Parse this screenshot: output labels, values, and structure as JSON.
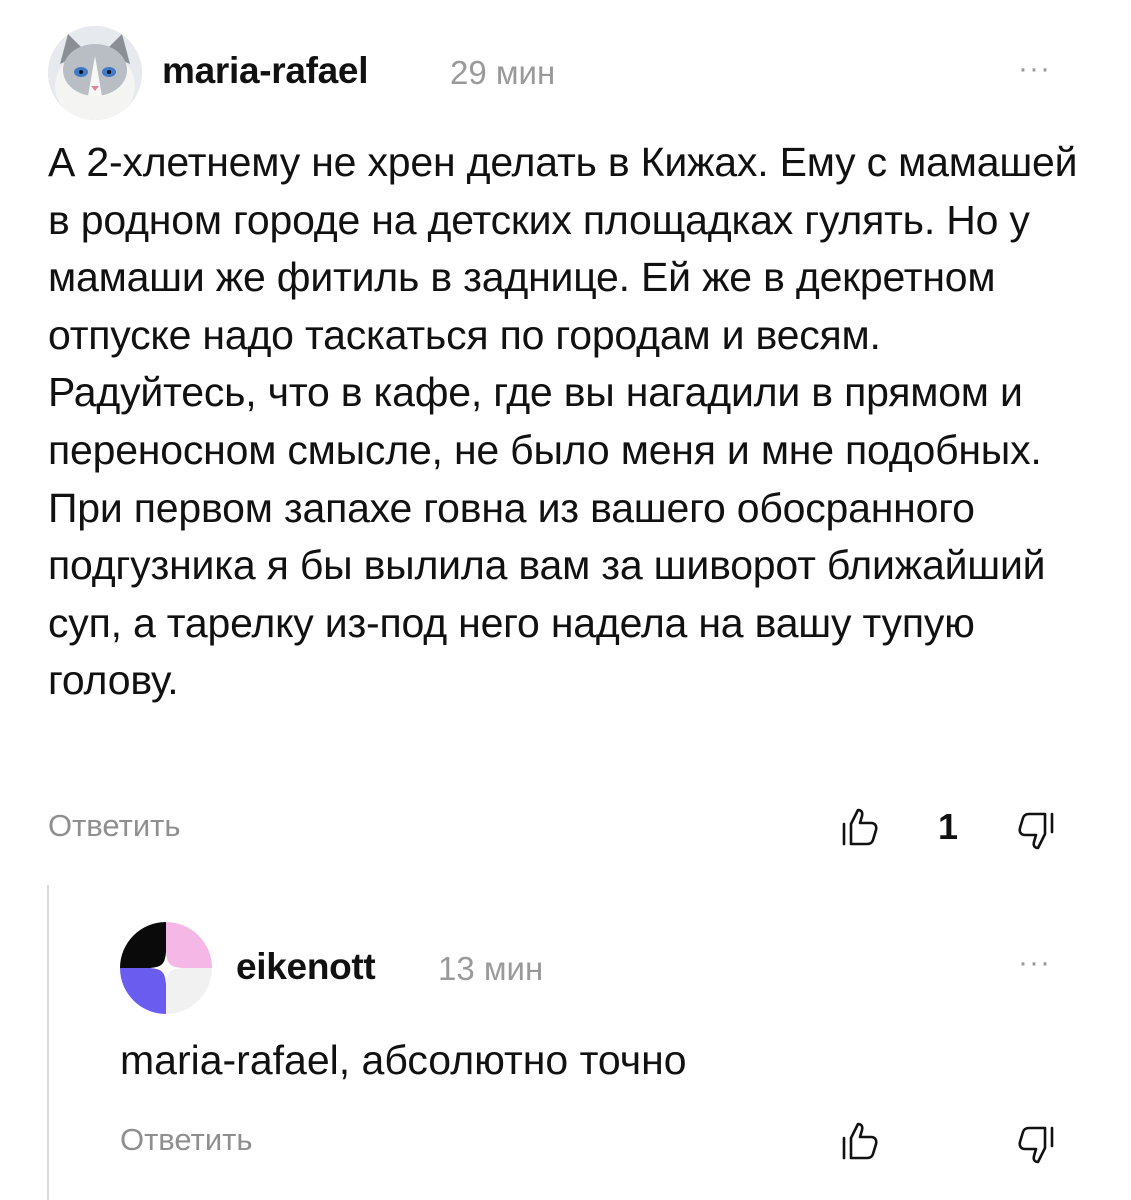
{
  "comments": [
    {
      "author": "maria-rafael",
      "time": "29 мин",
      "more_label": "···",
      "avatar_icon": "cat-avatar",
      "text": "А 2-хлетнему не хрен делать в Кижах. Ему с мамашей в родном городе на детских площадках гулять. Но у мамаши же фитиль в заднице. Ей же в декретном отпуске надо таскаться по городам и весям. Радуйтесь, что в кафе, где вы нагадили в прямом и переносном смысле, не было меня и мне подобных. При первом запахе говна из вашего обосранного подгузника я бы вылила вам за шиворот ближайший суп, а тарелку из-под него надела на вашу тупую голову.",
      "reply_label": "Ответить",
      "like_count": "1",
      "like_icon": "thumbs-up-icon",
      "dislike_icon": "thumbs-down-icon"
    },
    {
      "author": "eikenott",
      "time": "13 мин",
      "more_label": "···",
      "avatar_icon": "geometric-avatar",
      "text": "maria-rafael, абсолютно точно",
      "reply_label": "Ответить",
      "like_icon": "thumbs-up-icon",
      "dislike_icon": "thumbs-down-icon"
    }
  ],
  "colors": {
    "text": "#111111",
    "muted": "#9a9a9a",
    "thread_line": "#d9d9d9",
    "avatar_pink": "#f5b8e6",
    "avatar_purple": "#6b5cf0",
    "avatar_black": "#0a0a0a"
  }
}
